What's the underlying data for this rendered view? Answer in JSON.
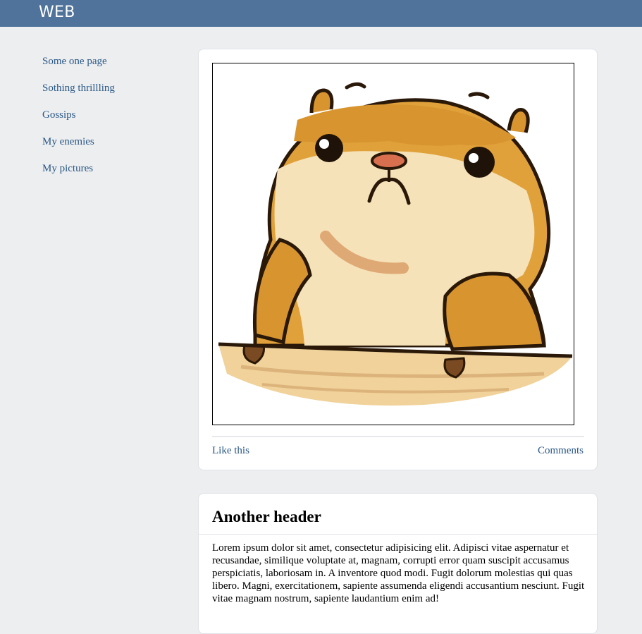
{
  "header": {
    "logo": "WEB"
  },
  "sidebar": {
    "items": [
      {
        "label": "Some one page"
      },
      {
        "label": "Sothing thrillling"
      },
      {
        "label": "Gossips"
      },
      {
        "label": "My enemies"
      },
      {
        "label": "My pictures"
      }
    ]
  },
  "post1": {
    "image": "hamster-illustration",
    "like_label": "Like this",
    "comments_label": "Comments"
  },
  "post2": {
    "title": "Another header",
    "body": "Lorem ipsum dolor sit amet, consectetur adipisicing elit. Adipisci vitae aspernatur et recusandae, similique voluptate at, magnam, corrupti error quam suscipit accusamus perspiciatis, laboriosam in. A inventore quod modi. Fugit dolorum molestias qui quas libero. Magni, exercitationem, sapiente assumenda eligendi accusantium nesciunt. Fugit vitae magnam nostrum, sapiente laudantium enim ad!"
  },
  "colors": {
    "topbar": "#4f739b",
    "link": "#2a5885",
    "page_bg": "#edeef0"
  }
}
